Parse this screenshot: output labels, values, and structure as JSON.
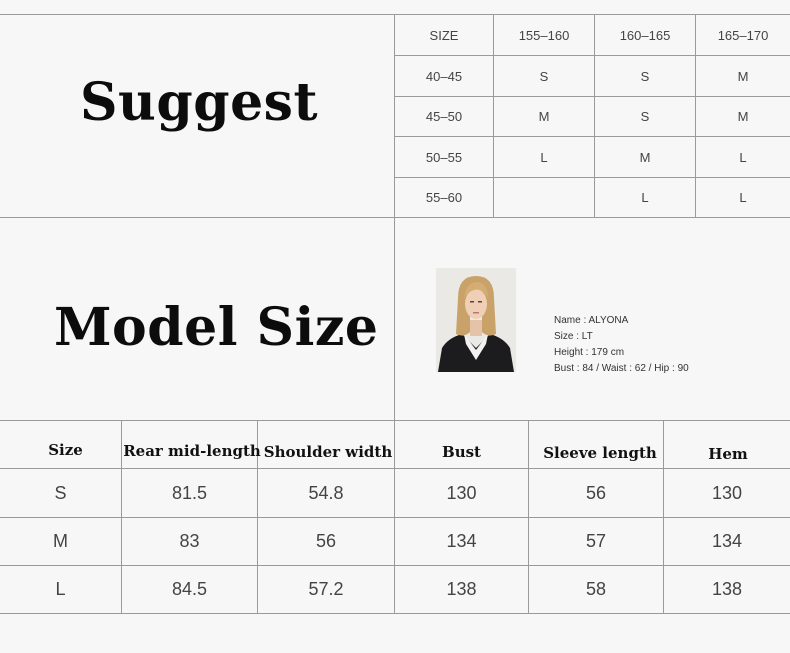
{
  "suggest": {
    "title": "Suggest",
    "header": [
      "SIZE",
      "155–160",
      "160–165",
      "165–170"
    ],
    "rows": [
      [
        "40–45",
        "S",
        "S",
        "M"
      ],
      [
        "45–50",
        "M",
        "S",
        "M"
      ],
      [
        "50–55",
        "L",
        "M",
        "L"
      ],
      [
        "55–60",
        "",
        "L",
        "L"
      ]
    ]
  },
  "model": {
    "title": "Model Size",
    "name": "Name : ALYONA",
    "size": "Size : LT",
    "height": "Height : 179  cm",
    "measurements": "Bust : 84 / Waist : 62 / Hip : 90"
  },
  "measure_table": {
    "headers": [
      "Size",
      "Rear mid-length",
      "Shoulder width",
      "Bust",
      "Sleeve length",
      "Hem"
    ],
    "rows": [
      [
        "S",
        "81.5",
        "54.8",
        "130",
        "56",
        "130"
      ],
      [
        "M",
        "83",
        "56",
        "134",
        "57",
        "134"
      ],
      [
        "L",
        "84.5",
        "57.2",
        "138",
        "58",
        "138"
      ]
    ]
  }
}
